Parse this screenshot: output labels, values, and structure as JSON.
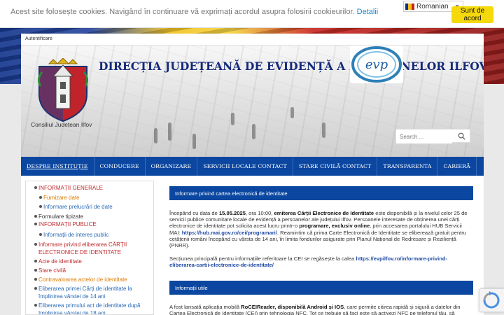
{
  "cookie": {
    "text": "Acest site folosește cookies. Navigând în continuare vă exprimați acordul asupra folosirii cookieurilor.",
    "link": "Detalii",
    "agree_label": "Sunt de acord",
    "language": "Romanian"
  },
  "top_bar": {
    "auth": "Autentificare"
  },
  "header": {
    "title": "DIRECȚIA JUDEȚEANĂ DE EVIDENȚĂ A PERSOANELOR ILFOV",
    "crest_label": "Consiliul Județean Ilfov",
    "logo_text": "evp",
    "search_placeholder": "Search ..."
  },
  "nav": {
    "items": [
      "DESPRE INSTITUȚIE",
      "CONDUCERE",
      "ORGANIZARE",
      "SERVICII LOCALE CONTACT",
      "STARE CIVILĂ CONTACT",
      "TRANSPARENTA",
      "CARIERĂ"
    ]
  },
  "sidebar": {
    "items": [
      "INFORMAȚII GENERALE",
      "Furnizare date",
      "Informare prelucrări de date",
      "Formulare tipizate",
      "INFORMAȚII PUBLICE",
      "Informații de interes public",
      "Informare privind eliberarea CĂRȚII ELECTRONICE DE IDENTITATE",
      "Acte de identitate",
      "Stare civilă",
      "Contravaloarea actelor de identitate",
      "Eliberarea primei Cărți de identitate la împlinirea vârstei de 14 ani",
      "Eliberarea primului act de identitate după împlinirea vârstei de 18 ani"
    ]
  },
  "content": {
    "section1_title": "Informare privind cartea electronică de identitate",
    "p1_a": "Începând cu data de ",
    "p1_date": "15.05.2025",
    "p1_b": ", ora 10:00, ",
    "p1_c": "emiterea Cărții Electronice de Identitate",
    "p1_d": " este disponibilă și la nivelul celor 25 de servicii publice comunitare locale de evidență a persoanelor ale județului Ilfov. Persoanele interesate de obținerea unei cărți electronice de identitate pot solicita acest lucru printr-o ",
    "p1_e": "programare, exclusiv online",
    "p1_f": ", prin accesarea portalului HUB Servicii MAI: ",
    "p1_link": "https://hub.mai.gov.ro/cei/programari/",
    "p1_g": ". Reamintim că prima Carte Electronică de Identitate se eliberează gratuit pentru cetățenii români începând cu vârsta de 14 ani, în limita fondurilor asigurate prin Planul Național de Redresare și Reziliență (PNRR).",
    "p2_a": "Secțiunea principală pentru informațiile referitoare la CEI se regăsește la calea ",
    "p2_link": "https://evpilfov.ro/informare-privind-eliberarea-cartii-electronice-de-identitate/",
    "section2_title": "Informații utile",
    "p3_a": "A fost lansată aplicația mobilă ",
    "p3_b": "RoCEIReader, disponibilă Android și IOS",
    "p3_c": ", care permite citirea rapidă și sigură a datelor din Cartea Electronică de Identitate (CEI) prin tehnologia NFC. Tot ce trebuie să faci este să activezi NFC pe telefonul tău, să"
  },
  "colors": {
    "nav_blue": "#0b47a0",
    "title_blue": "#15297a",
    "accent_yellow": "#f5d90a"
  }
}
